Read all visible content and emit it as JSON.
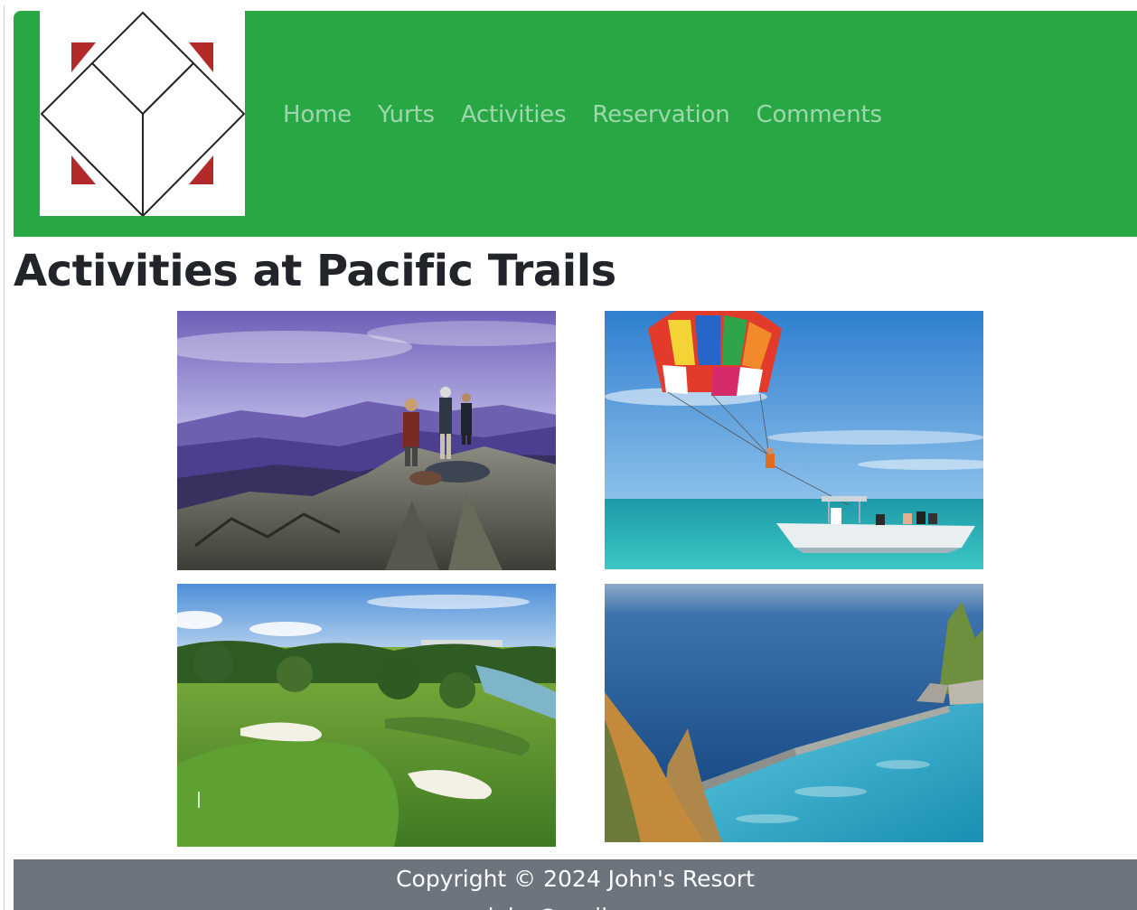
{
  "header": {
    "logo": "resort-logo",
    "nav": [
      "Home",
      "Yurts",
      "Activities",
      "Reservation",
      "Comments"
    ]
  },
  "main": {
    "title": "Activities at Pacific Trails",
    "photos": [
      {
        "subject": "hikers-on-mountain-summit"
      },
      {
        "subject": "parasailing-over-sea"
      },
      {
        "subject": "golf-course"
      },
      {
        "subject": "infinity-pool-over-ocean"
      }
    ]
  },
  "footer": {
    "copyright": "Copyright © 2024 John's Resort",
    "email": "john@mail.com"
  },
  "colors": {
    "header_bg": "#28a745",
    "footer_bg": "#6c757d",
    "logo_accent": "#b22a2a"
  }
}
